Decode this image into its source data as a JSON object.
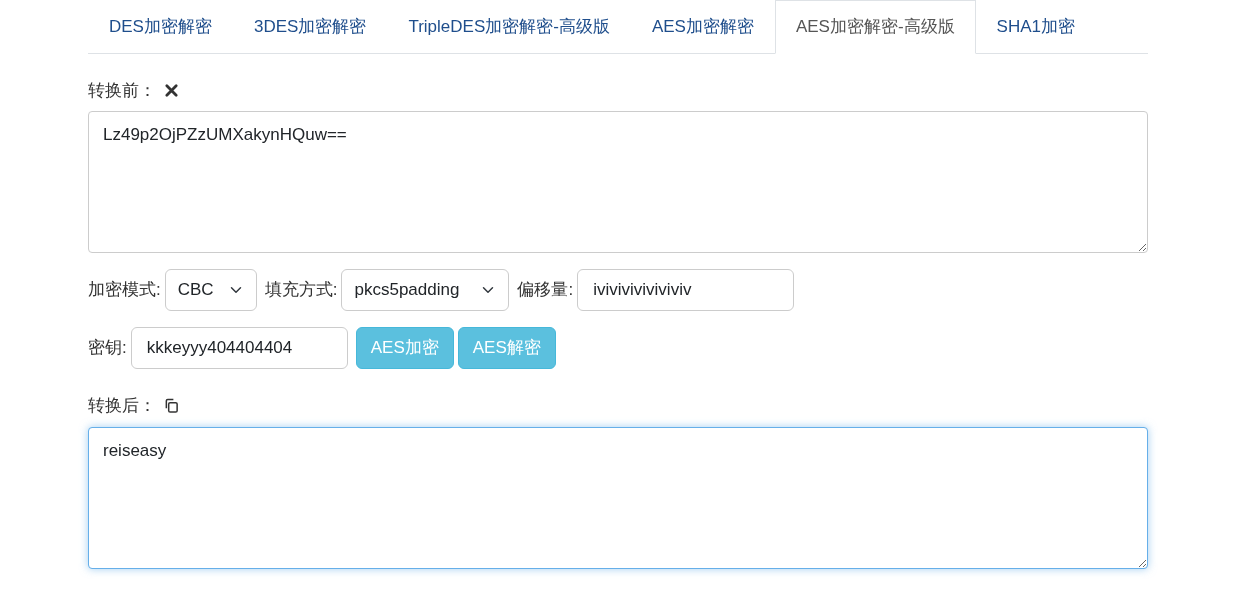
{
  "tabs": [
    {
      "label": "DES加密解密",
      "selected": false
    },
    {
      "label": "3DES加密解密",
      "selected": false
    },
    {
      "label": "TripleDES加密解密-高级版",
      "selected": false
    },
    {
      "label": "AES加密解密",
      "selected": false
    },
    {
      "label": "AES加密解密-高级版",
      "selected": true
    },
    {
      "label": "SHA1加密",
      "selected": false
    }
  ],
  "input": {
    "label": "转换前：",
    "value": "Lz49p2OjPZzUMXakynHQuw==",
    "focused": false
  },
  "mode": {
    "label": "加密模式:",
    "value": "CBC"
  },
  "padding": {
    "label": "填充方式:",
    "value": "pkcs5padding"
  },
  "iv": {
    "label": "偏移量:",
    "value": "iviviviviviviviv"
  },
  "key": {
    "label": "密钥:",
    "value": "kkkeyyy404404404"
  },
  "buttons": [
    "AES加密",
    "AES解密"
  ],
  "output": {
    "label": "转换后：",
    "value": "reiseasy",
    "focused": true
  }
}
